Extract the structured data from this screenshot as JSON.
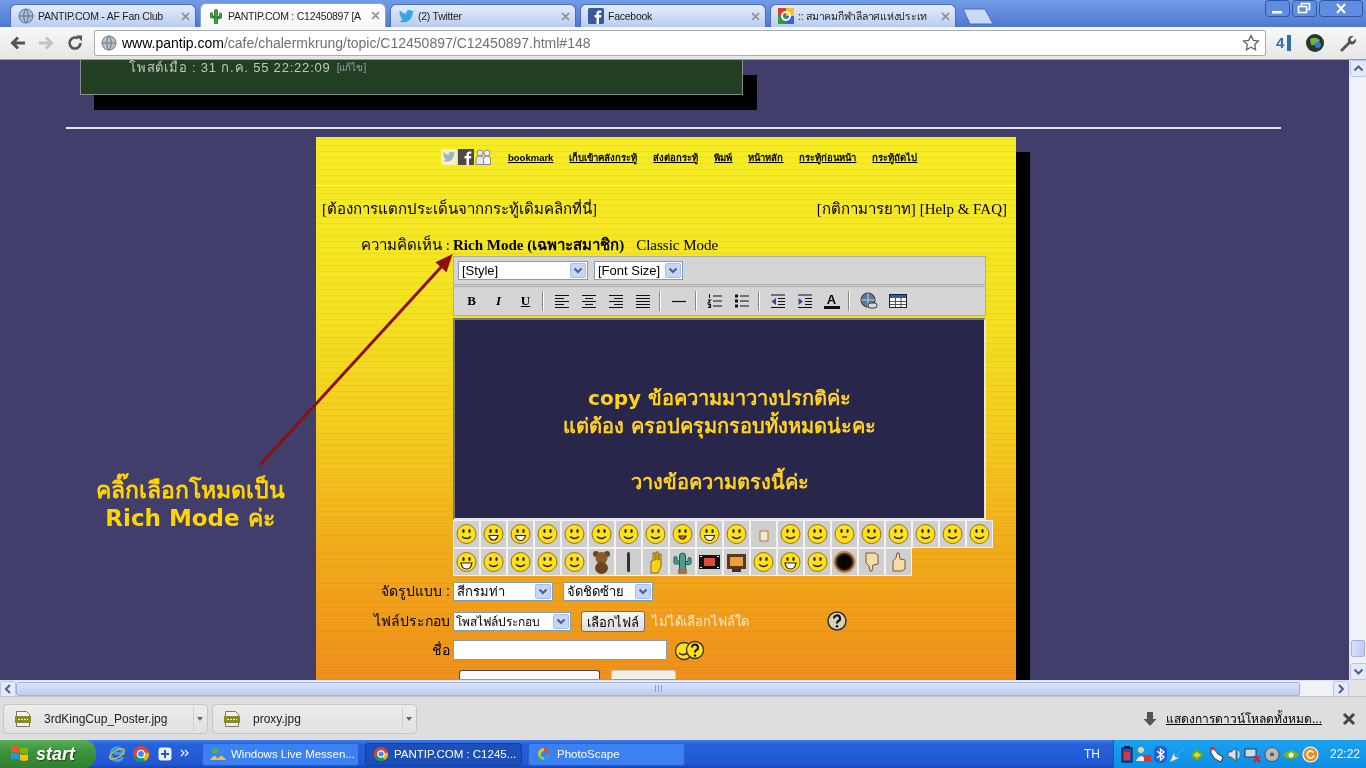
{
  "browser": {
    "tabs": [
      {
        "title": "PANTIP.COM - AF Fan Club",
        "selected": false
      },
      {
        "title": "PANTIP.COM : C12450897 [A",
        "selected": true
      },
      {
        "title": "(2) Twitter",
        "selected": false
      },
      {
        "title": "Facebook",
        "selected": false
      },
      {
        "title": ":: สมาคมกีฬาลีลาศแห่งประเท",
        "selected": false
      }
    ],
    "address": {
      "domain": "www.pantip.com",
      "path": "/cafe/chalermkrung/topic/C12450897/C12450897.html#148"
    },
    "extension_badge": "4"
  },
  "page": {
    "post_meta": "โพสต์เมื่อ : 31 ก.ค. 55 22:22:09",
    "post_edit_link": "[แก้ไข]",
    "share_links": [
      "bookmark",
      "เก็บเข้าคลังกระทู้",
      "ส่งต่อกระทู้",
      "พิมพ์",
      "หน้าหลัก",
      "กระทู้ก่อนหน้า",
      "กระทู้ถัดไป"
    ],
    "branch_link": "[ต้องการแตกประเด็นจากกระทู้เดิมคลิกที่นี่]",
    "help_links": [
      "[กติกามารยาท]",
      "[Help & FAQ]"
    ],
    "comment": {
      "label": "ความคิดเห็น :",
      "modes": [
        {
          "label": "Rich Mode (เฉพาะสมาชิก)",
          "selected": true
        },
        {
          "label": "Classic Mode",
          "selected": false
        }
      ]
    },
    "editor": {
      "style": "[Style]",
      "font_size": "[Font Size]",
      "toolbar": [
        {
          "kind": "bold",
          "label": "B"
        },
        {
          "kind": "italic",
          "label": "I"
        },
        {
          "kind": "underline",
          "label": "U"
        },
        {
          "kind": "separator"
        },
        {
          "kind": "align-left"
        },
        {
          "kind": "align-center"
        },
        {
          "kind": "align-right"
        },
        {
          "kind": "justify"
        },
        {
          "kind": "separator"
        },
        {
          "kind": "rule"
        },
        {
          "kind": "separator"
        },
        {
          "kind": "numbered-list"
        },
        {
          "kind": "bullet-list"
        },
        {
          "kind": "separator"
        },
        {
          "kind": "outdent"
        },
        {
          "kind": "indent"
        },
        {
          "kind": "font-color",
          "label": "A"
        },
        {
          "kind": "separator"
        },
        {
          "kind": "link"
        },
        {
          "kind": "table"
        }
      ],
      "paragraphs": [
        {
          "lines": [
            "copy ข้อความมาวางปรกติค่ะ",
            "แต่ต้อง ครอปครุมกรอบทั้งหมดน่ะคะ"
          ]
        },
        {
          "lines": [
            "วางข้อความตรงนี้ค่ะ"
          ]
        }
      ]
    },
    "format": {
      "label": "จัดรูปแบบ :",
      "selects": [
        "สีกรมท่า",
        "จัดชิดซ้าย"
      ]
    },
    "attachment": {
      "label": "ไฟล์ประกอบ",
      "type": "โพสไฟล์ประกอบ",
      "button": "เลือกไฟล์",
      "status": "ไม่ได้เลือกไฟล์ใด"
    },
    "name_field": {
      "label": "ชื่อ"
    }
  },
  "annotation": [
    "คลิ๊กเลือกโหมดเป็น",
    "Rich Mode ค่ะ"
  ],
  "downloads": {
    "items": [
      "3rdKingCup_Poster.jpg",
      "proxy.jpg"
    ],
    "show_all": "แสดงการดาวน์โหลดทั้งหมด..."
  },
  "taskbar": {
    "start": "start",
    "tasks": [
      {
        "title": "Windows Live Messen...",
        "selected": false
      },
      {
        "title": "PANTIP.COM : C1245...",
        "selected": true
      },
      {
        "title": "PhotoScape",
        "selected": false
      }
    ],
    "language": "TH",
    "clock": "22:22"
  }
}
